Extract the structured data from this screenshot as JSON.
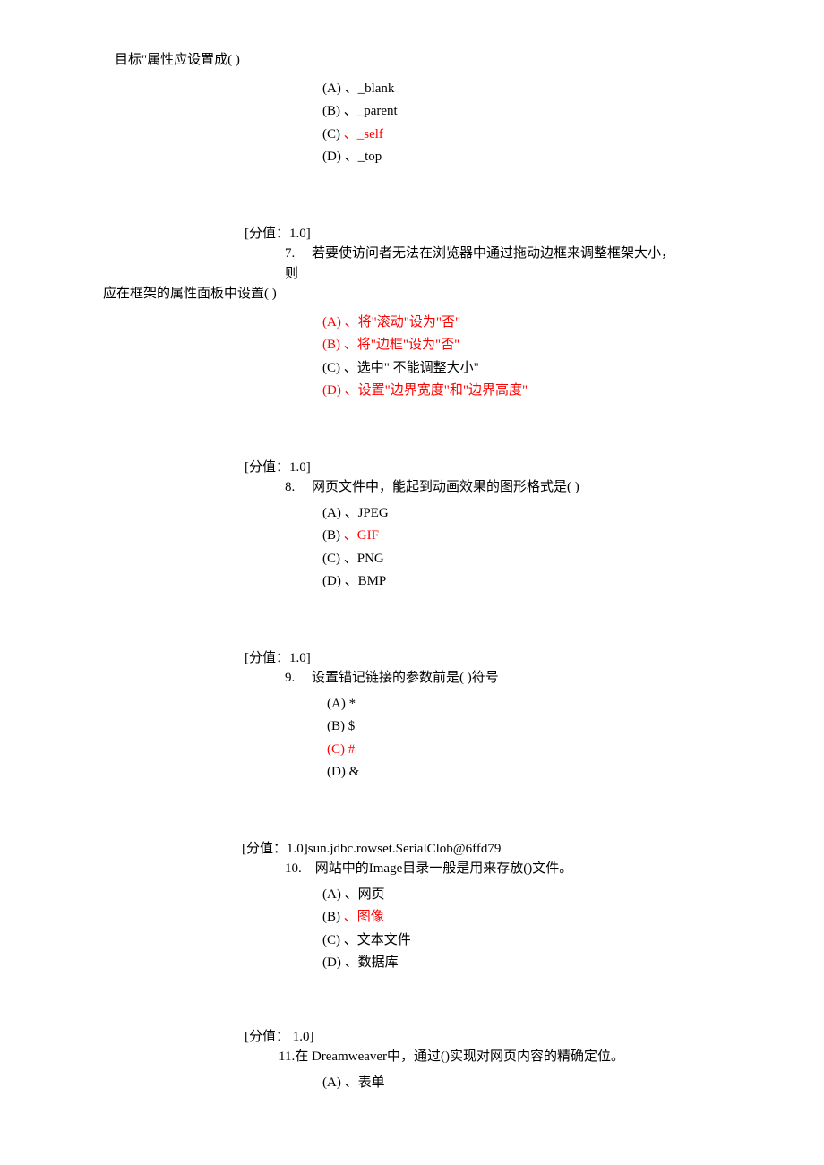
{
  "q6": {
    "stem": "目标\"属性应设置成(  )",
    "options": {
      "a": "(A)  、_blank",
      "b": "(B)  、_parent",
      "c_prefix": "(C)  ",
      "c_text": "、_self",
      "d": "(D) 、_top"
    }
  },
  "score_label_7": "[分值：1.0]",
  "q7": {
    "num_and_text": "7.  若要使访问者无法在浏览器中通过拖动边框来调整框架大小，",
    "ze": "则",
    "stem2": "应在框架的属性面板中设置(  )",
    "options": {
      "a": "(A)  、将\"滚动\"设为\"否\"",
      "b": "(B)  、将\"边框\"设为\"否\"",
      "c_prefix": "(C)  ",
      "c_text": "、选中\"  不能调整大小\"",
      "d": "(D)  、设置\"边界宽度\"和\"边界高度\""
    }
  },
  "score_label_8": "[分值：1.0]",
  "q8": {
    "num_and_text": "8.  网页文件中，能起到动画效果的图形格式是(  )",
    "options": {
      "a": "(A)  、JPEG",
      "b_prefix": "(B)  ",
      "b_text": "、GIF",
      "c": "(C)  、PNG",
      "d": "(D)  、BMP"
    }
  },
  "score_label_9": "[分值：1.0]",
  "q9": {
    "num_and_text": "9.  设置锚记链接的参数前是(  )符号",
    "options": {
      "a": "(A)  *",
      "b": "(B) $",
      "c": "(C) #",
      "d": "(D) &"
    }
  },
  "score_label_10": "[分值：1.0]sun.jdbc.rowset.SerialClob@6ffd79",
  "q10": {
    "num_and_text": "10. 网站中的Image目录一般是用来存放()文件。",
    "options": {
      "a": "(A)  、网页",
      "b_prefix": "(B)  ",
      "b_text": "、图像",
      "c": "(C)  、文本文件",
      "d": "(D)  、数据库"
    }
  },
  "score_label_11": "[分值： 1.0]",
  "q11": {
    "num_and_text": "11.在  Dreamweaver中，通过()实现对网页内容的精确定位。",
    "options": {
      "a": "(A)  、表单"
    }
  }
}
